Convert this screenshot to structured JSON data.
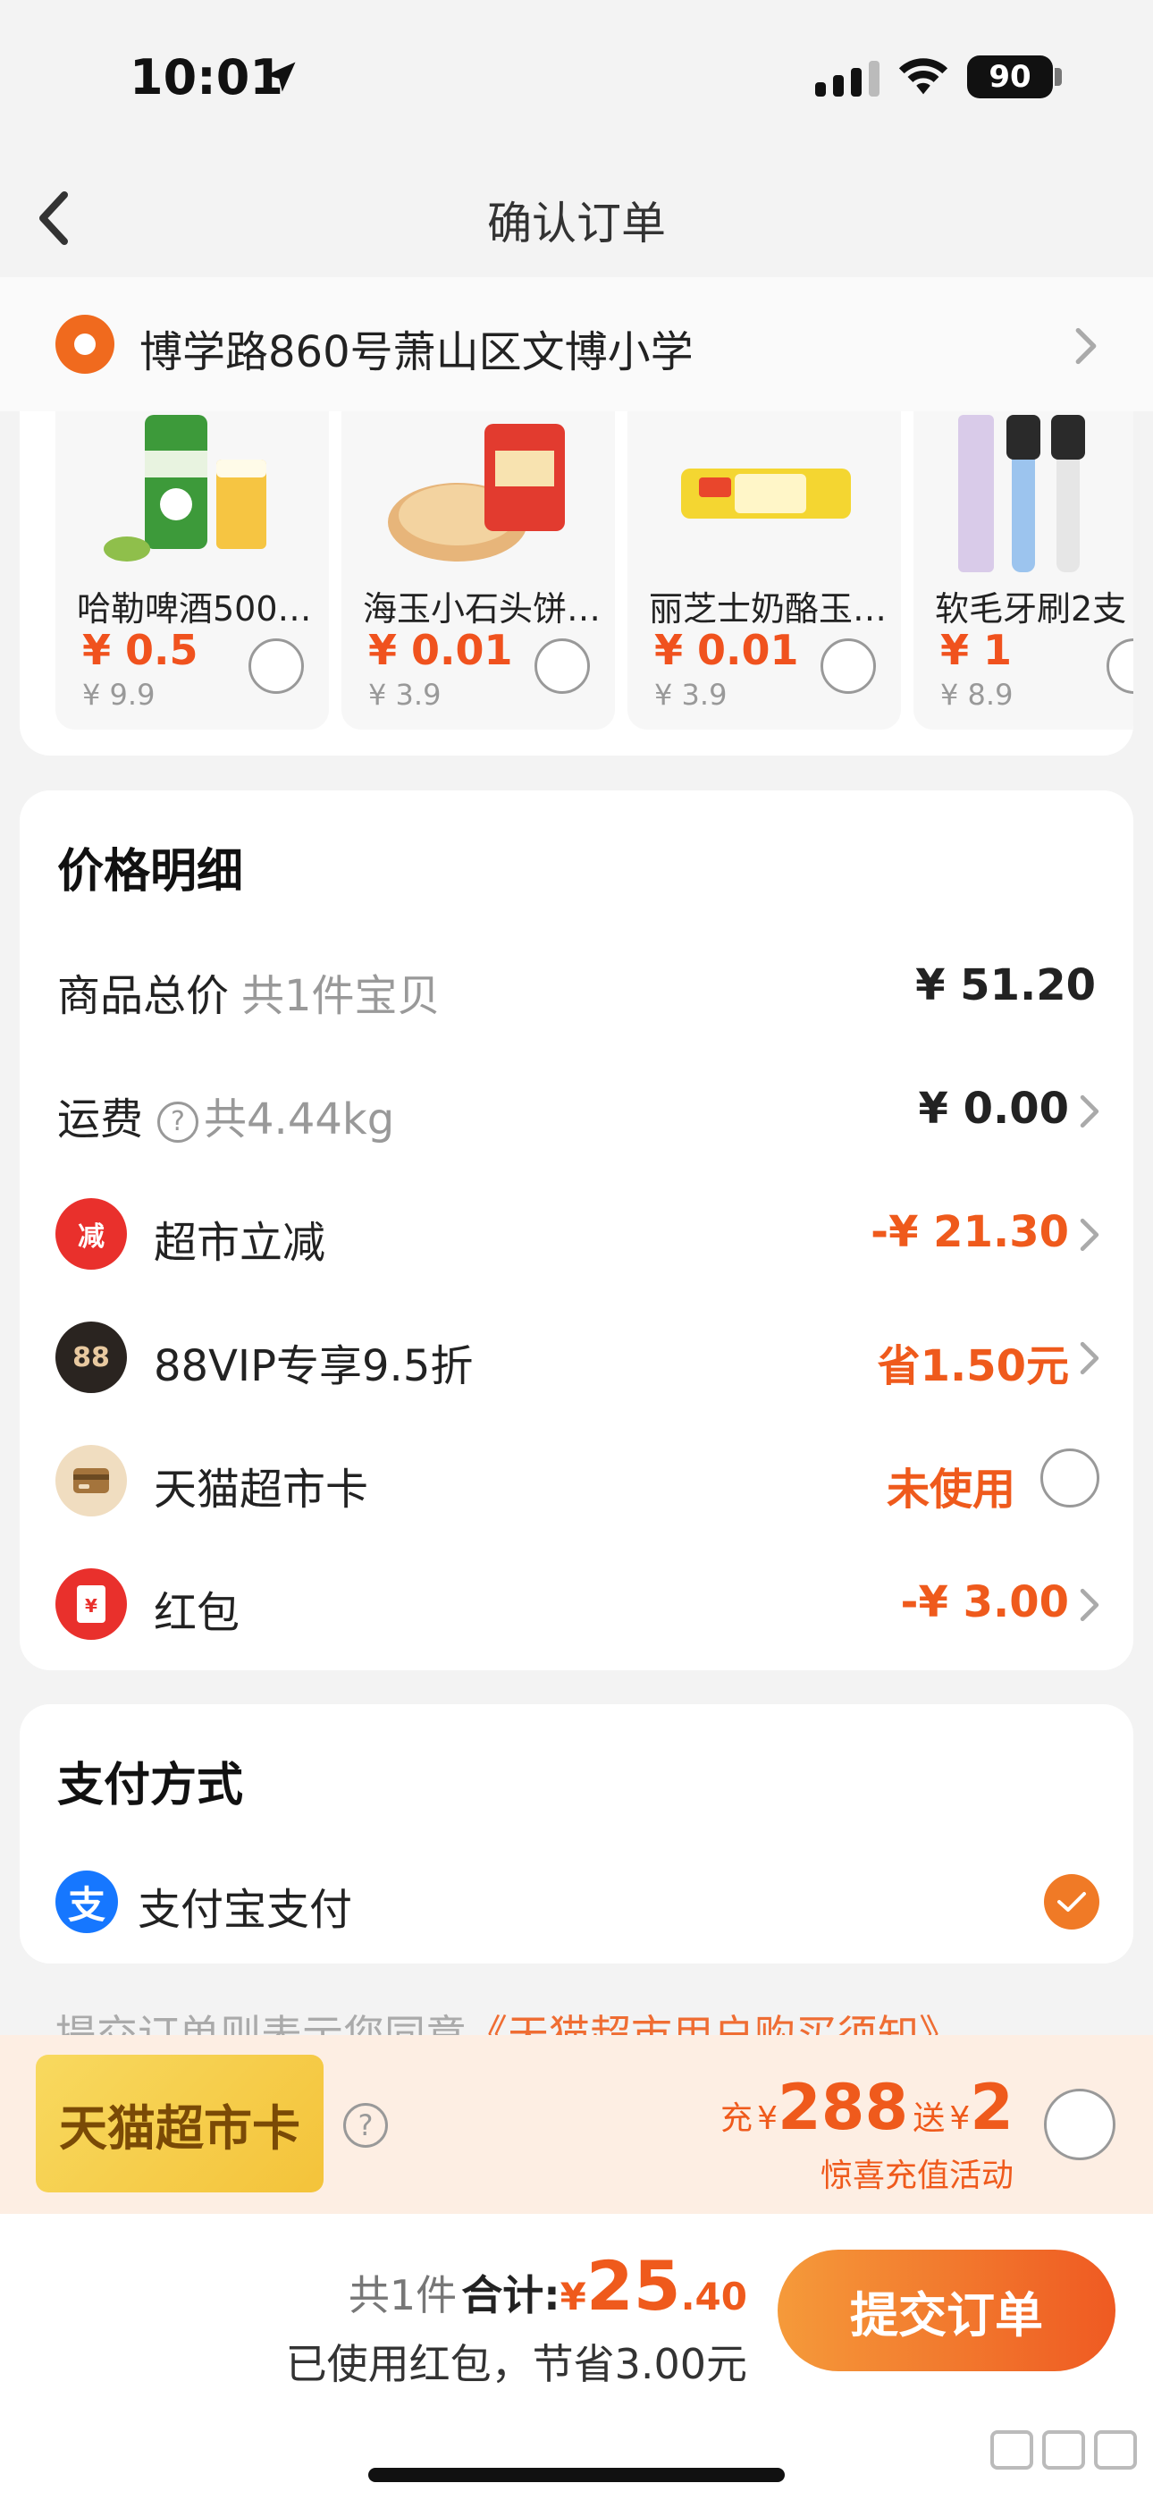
{
  "status_bar": {
    "time": "10:01",
    "battery": "90"
  },
  "nav": {
    "title": "确认订单"
  },
  "address": {
    "text": "博学路860号萧山区文博小学"
  },
  "products": [
    {
      "name": "哈勒啤酒500…",
      "price": "¥ 0.5",
      "original": "¥ 9.9"
    },
    {
      "name": "海玉小石头饼…",
      "price": "¥ 0.01",
      "original": "¥ 3.9"
    },
    {
      "name": "丽芝士奶酪玉…",
      "price": "¥ 0.01",
      "original": "¥ 3.9"
    },
    {
      "name": "软毛牙刷2支",
      "price": "¥ 1",
      "original": "¥ 8.9"
    }
  ],
  "price_detail": {
    "title": "价格明细",
    "goods_total": {
      "label": "商品总价",
      "sub": "共1件宝贝",
      "value": "¥ 51.20"
    },
    "shipping": {
      "label": "运费",
      "sub": "共4.44kg",
      "value": "¥ 0.00"
    },
    "discount": {
      "icon_text": "减",
      "label": "超市立减",
      "value": "-¥ 21.30"
    },
    "vip": {
      "icon_text": "88",
      "label": "88VIP专享9.5折",
      "value": "省1.50元"
    },
    "market_card": {
      "label": "天猫超市卡",
      "value": "未使用"
    },
    "red_packet": {
      "icon_text": "¥",
      "label": "红包",
      "value": "-¥ 3.00"
    }
  },
  "payment": {
    "title": "支付方式",
    "method_icon": "支",
    "method": "支付宝支付"
  },
  "agreement": {
    "prefix": "提交订单则表示您同意",
    "link": "《天猫超市用户购买须知》"
  },
  "promo": {
    "badge": "天猫超市卡",
    "charge_label": "充",
    "charge_yen": "¥",
    "charge_amount": "288",
    "gift_label": "送",
    "gift_yen": "¥",
    "gift_amount": "2",
    "subtitle": "惊喜充值活动"
  },
  "bottom": {
    "count": "共1件",
    "total_label": "合计:",
    "yen": "¥",
    "total_int": "25",
    "total_dec": ".40",
    "saved": "已使用红包，节省3.00元",
    "submit": "提交订单"
  },
  "colors": {
    "accent": "#ef5a1c",
    "alipay": "#1677ff"
  }
}
